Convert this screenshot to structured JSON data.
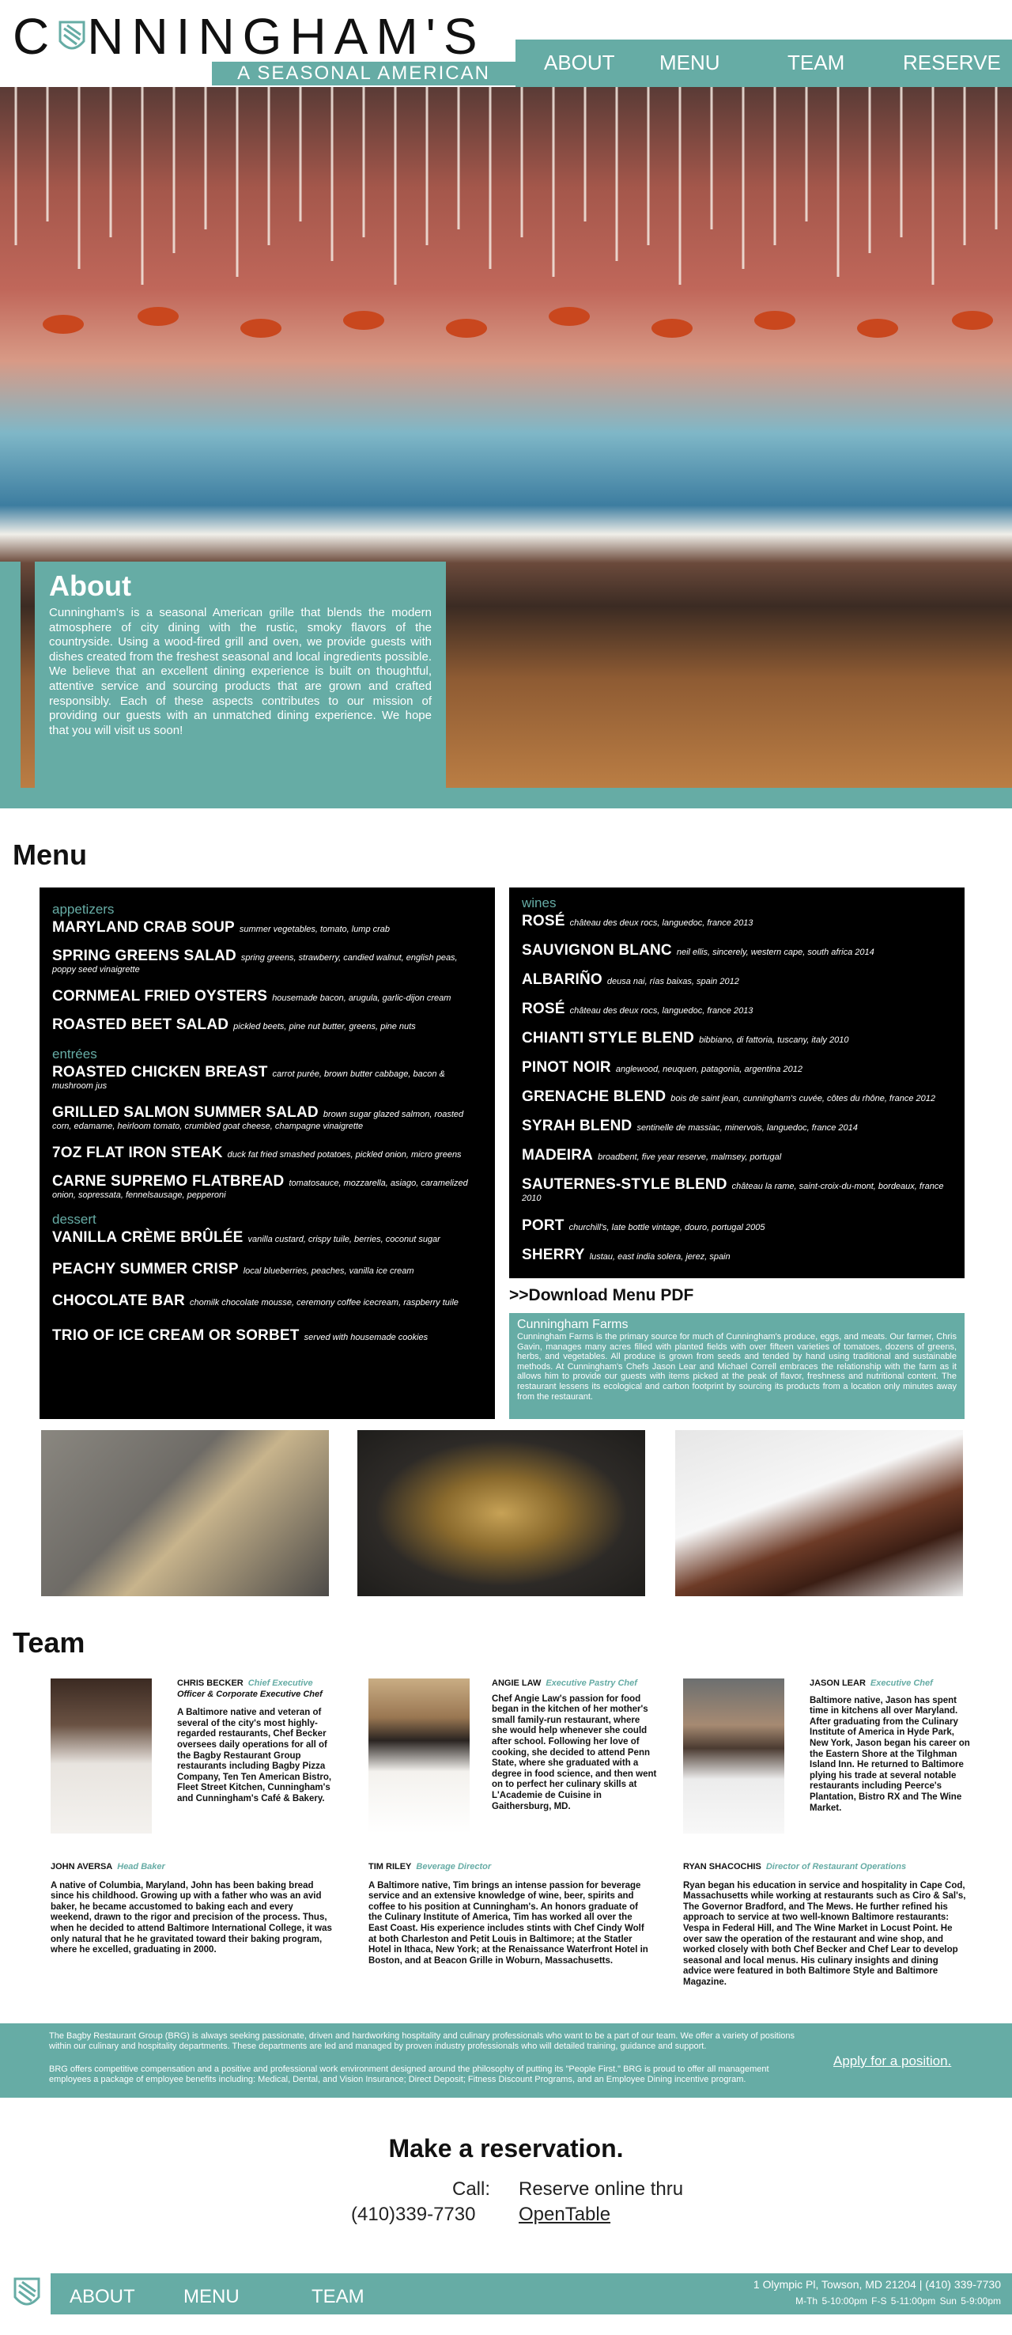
{
  "brand": {
    "name": "CUNNINGHAM'S",
    "tagline": "A SEASONAL AMERICAN GRILL",
    "accent": "#66aca5"
  },
  "nav": {
    "about": "ABOUT",
    "menu": "MENU",
    "team": "TEAM",
    "reserve": "RESERVE"
  },
  "about": {
    "title": "About",
    "body": "Cunningham's is a seasonal American grille that blends the modern atmosphere of city dining with the rustic, smoky flavors of the countryside. Using a wood-fired grill and oven, we provide guests with dishes created from the freshest seasonal and local ingredients possible. We believe that an excellent dining experience is built on thoughtful, attentive service and sourcing products that are grown and crafted responsibly. Each of these aspects contributes to our mission of providing our guests with an unmatched dining experience. We hope that you will visit us soon!"
  },
  "menu": {
    "title": "Menu",
    "appetizers_label": "appetizers",
    "appetizers": [
      {
        "name": "MARYLAND CRAB SOUP",
        "desc": "summer vegetables, tomato, lump crab"
      },
      {
        "name": "SPRING GREENS SALAD",
        "desc": "spring greens, strawberry, candied walnut, english peas, poppy seed vinaigrette"
      },
      {
        "name": "CORNMEAL FRIED OYSTERS",
        "desc": "housemade bacon, arugula, garlic-dijon cream"
      },
      {
        "name": "ROASTED BEET SALAD",
        "desc": "pickled beets, pine nut butter, greens, pine nuts"
      }
    ],
    "entrees_label": "entrées",
    "entrees": [
      {
        "name": "ROASTED CHICKEN BREAST",
        "desc": "carrot purée, brown butter cabbage, bacon & mushroom jus"
      },
      {
        "name": "GRILLED SALMON SUMMER SALAD",
        "desc": "brown sugar glazed salmon, roasted corn, edamame, heirloom tomato, crumbled goat cheese, champagne vinaigrette"
      },
      {
        "name": "7OZ FLAT IRON STEAK",
        "desc": "duck fat fried smashed potatoes, pickled onion, micro greens"
      },
      {
        "name": "CARNE SUPREMO FLATBREAD",
        "desc": "tomatosauce, mozzarella, asiago, caramelized onion, sopressata, fennelsausage, pepperoni"
      }
    ],
    "dessert_label": "dessert",
    "desserts": [
      {
        "name": "VANILLA CRÈME BRÛLÉE",
        "desc": "vanilla custard, crispy tuile, berries, coconut sugar"
      },
      {
        "name": "PEACHY SUMMER CRISP",
        "desc": "local blueberries, peaches, vanilla ice cream"
      },
      {
        "name": "CHOCOLATE BAR",
        "desc": "chomilk chocolate mousse, ceremony coffee icecream, raspberry tuile"
      },
      {
        "name": "TRIO OF ICE CREAM OR SORBET",
        "desc": "served with housemade cookies"
      }
    ],
    "wines_label": "wines",
    "wines": [
      {
        "name": "ROSÉ",
        "desc": "château des deux rocs, languedoc, france 2013"
      },
      {
        "name": "SAUVIGNON BLANC",
        "desc": "neil ellis, sincerely, western cape, south africa 2014"
      },
      {
        "name": "ALBARIÑO",
        "desc": "deusa nai, rías baixas, spain 2012"
      },
      {
        "name": "ROSÉ",
        "desc": "château des deux rocs, languedoc, france 2013"
      },
      {
        "name": "CHIANTI STYLE BLEND",
        "desc": "bibbiano, di fattoria, tuscany, italy 2010"
      },
      {
        "name": "PINOT NOIR",
        "desc": "anglewood, neuquen, patagonia, argentina 2012"
      },
      {
        "name": "GRENACHE BLEND",
        "desc": "bois de saint jean, cunningham's cuvée, côtes du rhône, france 2012"
      },
      {
        "name": "SYRAH BLEND",
        "desc": "sentinelle de massiac, minervois, languedoc, france 2014"
      },
      {
        "name": "MADEIRA",
        "desc": "broadbent, five year reserve, malmsey, portugal"
      },
      {
        "name": "SAUTERNES-STYLE BLEND",
        "desc": "château la rame, saint-croix-du-mont, bordeaux, france 2010"
      },
      {
        "name": "PORT",
        "desc": "churchill's, late bottle vintage, douro, portugal 2005"
      },
      {
        "name": "SHERRY",
        "desc": "lustau, east india solera, jerez, spain"
      }
    ],
    "download": ">>Download Menu PDF"
  },
  "farms": {
    "title": "Cunningham Farms",
    "body": "Cunningham Farms is the primary source for much of Cunningham's produce, eggs, and meats. Our farmer, Chris Gavin, manages many acres filled with planted fields with over fifteen varieties of tomatoes, dozens of greens, herbs, and vegetables. All produce is grown from seeds and tended by hand using traditional and sustainable methods. At Cunningham's Chefs Jason Lear and Michael Correll embraces the relationship with the farm as it allows him to provide our guests with items picked at the peak of flavor, freshness and nutritional content. The restaurant lessens its ecological and carbon footprint by sourcing its products from a location only minutes away from the restaurant."
  },
  "team": {
    "title": "Team",
    "members": [
      {
        "name": "CHRIS BECKER",
        "role": "Chief Executive",
        "role2": "Officer & Corporate Executive Chef",
        "bio": "A Baltimore native and veteran of several of the city's most highly-regarded restaurants, Chef Becker oversees daily operations for all of the Bagby Restaurant Group restaurants including Bagby Pizza Company, Ten Ten American Bistro, Fleet Street Kitchen, Cunningham's and Cunningham's Café & Bakery."
      },
      {
        "name": "ANGIE LAW",
        "role": "Executive Pastry Chef",
        "role2": "",
        "bio": "Chef Angie Law's passion for food began in the kitchen of her mother's small family-run restaurant, where she would help whenever she could after school. Following her love of cooking, she decided to attend Penn State, where she graduated with a degree in food science, and then went on to perfect her culinary skills at L'Academie de Cuisine in Gaithersburg, MD."
      },
      {
        "name": "JASON LEAR",
        "role": "Executive Chef",
        "role2": "",
        "bio": "Baltimore native, Jason has spent time in kitchens all over Maryland. After graduating from the Culinary Institute of America in Hyde Park, New York, Jason began his career on the Eastern Shore at the Tilghman Island Inn. He returned to Baltimore plying his trade at several notable restaurants including Peerce's Plantation, Bistro RX and The Wine Market."
      },
      {
        "name": "JOHN AVERSA",
        "role": "Head Baker",
        "role2": "",
        "bio": "A native of Columbia, Maryland, John has been baking bread since his childhood. Growing up with a father who was an avid baker, he became accustomed to baking each and every weekend, drawn to the rigor and precision of the process. Thus, when he decided to attend Baltimore International College, it was only natural that he he gravitated toward their baking program, where he excelled, graduating in 2000."
      },
      {
        "name": "TIM RILEY",
        "role": "Beverage Director",
        "role2": "",
        "bio": "A Baltimore native, Tim brings an intense passion for beverage service and an extensive knowledge of wine, beer, spirits and coffee to his position at Cunningham's. An honors graduate of the Culinary Institute of America, Tim has worked all over the East Coast. His experience includes stints with Chef Cindy Wolf at both Charleston and Petit Louis in Baltimore; at the Statler Hotel in Ithaca, New York; at the Renaissance Waterfront Hotel in Boston, and at Beacon Grille in Woburn, Massachusetts."
      },
      {
        "name": "RYAN SHACOCHIS",
        "role": "Director of Restaurant Operations",
        "role2": "",
        "bio": "Ryan began his education in service and hospitality in Cape Cod, Massachusetts while working at restaurants such as Ciro & Sal's, The Governor Bradford, and The Mews. He further refined his approach to service at two well-known Baltimore restaurants: Vespa in Federal Hill, and The Wine Market in Locust Point. He over saw the operation of the restaurant and wine shop, and worked closely with both Chef Becker and Chef Lear to develop seasonal and local menus. His culinary insights and dining advice were featured in both Baltimore Style and Baltimore Magazine."
      }
    ]
  },
  "jobs": {
    "p1": "The Bagby Restaurant Group (BRG) is always seeking passionate, driven and hardworking hospitality and culinary professionals who want to be a part of our team. We offer a variety of positions within our culinary and hospitality departments. These departments are led and managed by proven industry professionals who will detailed training, guidance and support.",
    "p2": "BRG offers competitive compensation and a positive and professional work environment designed around the philosophy of putting its \"People First.\" BRG is proud to offer all management employees a package of employee benefits including: Medical, Dental, and Vision Insurance; Direct Deposit; Fitness Discount Programs, and an Employee Dining incentive program.",
    "apply": "Apply for a position."
  },
  "reservation": {
    "title": "Make a reservation.",
    "call_label": "Call:",
    "phone": "(410)339-7730",
    "online_label": "Reserve online thru",
    "online_link": "OpenTable"
  },
  "footer": {
    "about": "ABOUT",
    "menu": "MENU",
    "team": "TEAM",
    "address": "1 Olympic Pl, Towson, MD 21204 | (410) 339-7730",
    "hours": "M-Th 5-10:00pm    F-S 5-11:00pm    Sun 5-9:00pm"
  }
}
